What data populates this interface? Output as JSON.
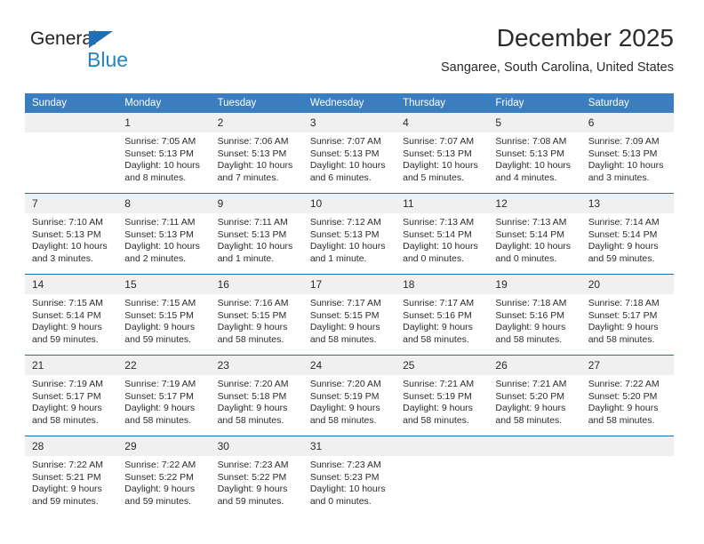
{
  "brand": {
    "name_part1": "General",
    "name_part2": "Blue",
    "triangle_color": "#1f6fb5",
    "blue_color": "#2484c6"
  },
  "header": {
    "title": "December 2025",
    "subtitle": "Sangaree, South Carolina, United States"
  },
  "theme": {
    "header_row_bg": "#3a7ebf",
    "header_row_text": "#ffffff",
    "daynum_bg": "#f0f0f0",
    "week_separator": "#1f6fb5",
    "body_text": "#2b2b2b"
  },
  "weekday_headers": [
    "Sunday",
    "Monday",
    "Tuesday",
    "Wednesday",
    "Thursday",
    "Friday",
    "Saturday"
  ],
  "labels": {
    "sunrise_prefix": "Sunrise: ",
    "sunset_prefix": "Sunset: ",
    "daylight_prefix": "Daylight: "
  },
  "weeks": [
    [
      {
        "day": "",
        "empty": true,
        "sunrise": "",
        "sunset": "",
        "daylight": ""
      },
      {
        "day": "1",
        "empty": false,
        "sunrise": "Sunrise: 7:05 AM",
        "sunset": "Sunset: 5:13 PM",
        "daylight": "Daylight: 10 hours and 8 minutes."
      },
      {
        "day": "2",
        "empty": false,
        "sunrise": "Sunrise: 7:06 AM",
        "sunset": "Sunset: 5:13 PM",
        "daylight": "Daylight: 10 hours and 7 minutes."
      },
      {
        "day": "3",
        "empty": false,
        "sunrise": "Sunrise: 7:07 AM",
        "sunset": "Sunset: 5:13 PM",
        "daylight": "Daylight: 10 hours and 6 minutes."
      },
      {
        "day": "4",
        "empty": false,
        "sunrise": "Sunrise: 7:07 AM",
        "sunset": "Sunset: 5:13 PM",
        "daylight": "Daylight: 10 hours and 5 minutes."
      },
      {
        "day": "5",
        "empty": false,
        "sunrise": "Sunrise: 7:08 AM",
        "sunset": "Sunset: 5:13 PM",
        "daylight": "Daylight: 10 hours and 4 minutes."
      },
      {
        "day": "6",
        "empty": false,
        "sunrise": "Sunrise: 7:09 AM",
        "sunset": "Sunset: 5:13 PM",
        "daylight": "Daylight: 10 hours and 3 minutes."
      }
    ],
    [
      {
        "day": "7",
        "empty": false,
        "sunrise": "Sunrise: 7:10 AM",
        "sunset": "Sunset: 5:13 PM",
        "daylight": "Daylight: 10 hours and 3 minutes."
      },
      {
        "day": "8",
        "empty": false,
        "sunrise": "Sunrise: 7:11 AM",
        "sunset": "Sunset: 5:13 PM",
        "daylight": "Daylight: 10 hours and 2 minutes."
      },
      {
        "day": "9",
        "empty": false,
        "sunrise": "Sunrise: 7:11 AM",
        "sunset": "Sunset: 5:13 PM",
        "daylight": "Daylight: 10 hours and 1 minute."
      },
      {
        "day": "10",
        "empty": false,
        "sunrise": "Sunrise: 7:12 AM",
        "sunset": "Sunset: 5:13 PM",
        "daylight": "Daylight: 10 hours and 1 minute."
      },
      {
        "day": "11",
        "empty": false,
        "sunrise": "Sunrise: 7:13 AM",
        "sunset": "Sunset: 5:14 PM",
        "daylight": "Daylight: 10 hours and 0 minutes."
      },
      {
        "day": "12",
        "empty": false,
        "sunrise": "Sunrise: 7:13 AM",
        "sunset": "Sunset: 5:14 PM",
        "daylight": "Daylight: 10 hours and 0 minutes."
      },
      {
        "day": "13",
        "empty": false,
        "sunrise": "Sunrise: 7:14 AM",
        "sunset": "Sunset: 5:14 PM",
        "daylight": "Daylight: 9 hours and 59 minutes."
      }
    ],
    [
      {
        "day": "14",
        "empty": false,
        "sunrise": "Sunrise: 7:15 AM",
        "sunset": "Sunset: 5:14 PM",
        "daylight": "Daylight: 9 hours and 59 minutes."
      },
      {
        "day": "15",
        "empty": false,
        "sunrise": "Sunrise: 7:15 AM",
        "sunset": "Sunset: 5:15 PM",
        "daylight": "Daylight: 9 hours and 59 minutes."
      },
      {
        "day": "16",
        "empty": false,
        "sunrise": "Sunrise: 7:16 AM",
        "sunset": "Sunset: 5:15 PM",
        "daylight": "Daylight: 9 hours and 58 minutes."
      },
      {
        "day": "17",
        "empty": false,
        "sunrise": "Sunrise: 7:17 AM",
        "sunset": "Sunset: 5:15 PM",
        "daylight": "Daylight: 9 hours and 58 minutes."
      },
      {
        "day": "18",
        "empty": false,
        "sunrise": "Sunrise: 7:17 AM",
        "sunset": "Sunset: 5:16 PM",
        "daylight": "Daylight: 9 hours and 58 minutes."
      },
      {
        "day": "19",
        "empty": false,
        "sunrise": "Sunrise: 7:18 AM",
        "sunset": "Sunset: 5:16 PM",
        "daylight": "Daylight: 9 hours and 58 minutes."
      },
      {
        "day": "20",
        "empty": false,
        "sunrise": "Sunrise: 7:18 AM",
        "sunset": "Sunset: 5:17 PM",
        "daylight": "Daylight: 9 hours and 58 minutes."
      }
    ],
    [
      {
        "day": "21",
        "empty": false,
        "sunrise": "Sunrise: 7:19 AM",
        "sunset": "Sunset: 5:17 PM",
        "daylight": "Daylight: 9 hours and 58 minutes."
      },
      {
        "day": "22",
        "empty": false,
        "sunrise": "Sunrise: 7:19 AM",
        "sunset": "Sunset: 5:17 PM",
        "daylight": "Daylight: 9 hours and 58 minutes."
      },
      {
        "day": "23",
        "empty": false,
        "sunrise": "Sunrise: 7:20 AM",
        "sunset": "Sunset: 5:18 PM",
        "daylight": "Daylight: 9 hours and 58 minutes."
      },
      {
        "day": "24",
        "empty": false,
        "sunrise": "Sunrise: 7:20 AM",
        "sunset": "Sunset: 5:19 PM",
        "daylight": "Daylight: 9 hours and 58 minutes."
      },
      {
        "day": "25",
        "empty": false,
        "sunrise": "Sunrise: 7:21 AM",
        "sunset": "Sunset: 5:19 PM",
        "daylight": "Daylight: 9 hours and 58 minutes."
      },
      {
        "day": "26",
        "empty": false,
        "sunrise": "Sunrise: 7:21 AM",
        "sunset": "Sunset: 5:20 PM",
        "daylight": "Daylight: 9 hours and 58 minutes."
      },
      {
        "day": "27",
        "empty": false,
        "sunrise": "Sunrise: 7:22 AM",
        "sunset": "Sunset: 5:20 PM",
        "daylight": "Daylight: 9 hours and 58 minutes."
      }
    ],
    [
      {
        "day": "28",
        "empty": false,
        "sunrise": "Sunrise: 7:22 AM",
        "sunset": "Sunset: 5:21 PM",
        "daylight": "Daylight: 9 hours and 59 minutes."
      },
      {
        "day": "29",
        "empty": false,
        "sunrise": "Sunrise: 7:22 AM",
        "sunset": "Sunset: 5:22 PM",
        "daylight": "Daylight: 9 hours and 59 minutes."
      },
      {
        "day": "30",
        "empty": false,
        "sunrise": "Sunrise: 7:23 AM",
        "sunset": "Sunset: 5:22 PM",
        "daylight": "Daylight: 9 hours and 59 minutes."
      },
      {
        "day": "31",
        "empty": false,
        "sunrise": "Sunrise: 7:23 AM",
        "sunset": "Sunset: 5:23 PM",
        "daylight": "Daylight: 10 hours and 0 minutes."
      },
      {
        "day": "",
        "empty": true,
        "sunrise": "",
        "sunset": "",
        "daylight": ""
      },
      {
        "day": "",
        "empty": true,
        "sunrise": "",
        "sunset": "",
        "daylight": ""
      },
      {
        "day": "",
        "empty": true,
        "sunrise": "",
        "sunset": "",
        "daylight": ""
      }
    ]
  ]
}
